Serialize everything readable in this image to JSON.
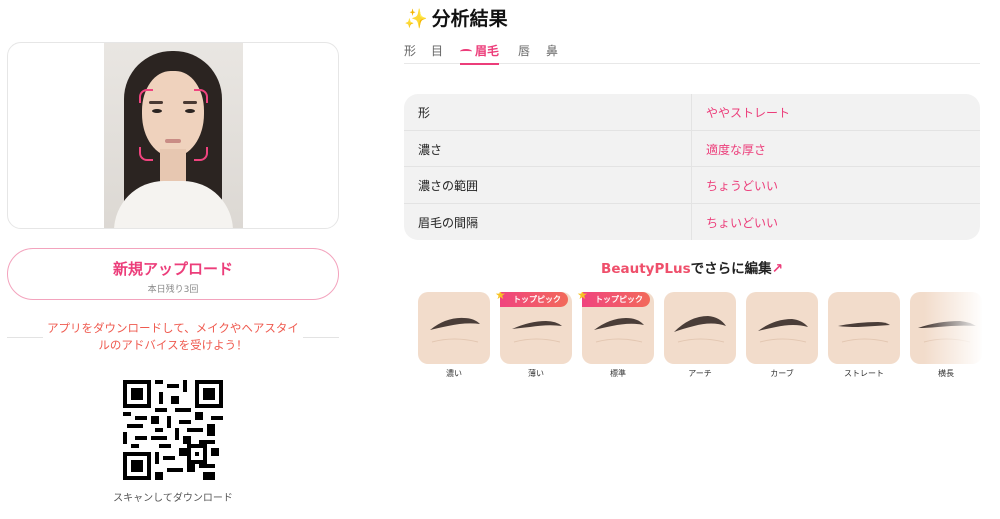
{
  "upload": {
    "title": "新規アップロード",
    "remaining": "本日残り3回"
  },
  "promo": {
    "line1": "アプリをダウンロードして、メイクやヘアスタイ",
    "line2": "ルのアドバイスを受けよう！"
  },
  "qr": {
    "caption": "スキャンしてダウンロード"
  },
  "analysis": {
    "sparkle": "✨",
    "title": "分析結果",
    "tabs": [
      "形",
      "目",
      "眉毛",
      "唇",
      "鼻"
    ],
    "active_tab": "眉毛",
    "rows": [
      {
        "label": "形",
        "value": "ややストレート"
      },
      {
        "label": "濃さ",
        "value": "適度な厚さ"
      },
      {
        "label": "濃さの範囲",
        "value": "ちょうどいい"
      },
      {
        "label": "眉毛の間隔",
        "value": "ちょいどいい"
      }
    ]
  },
  "edit_link": {
    "brand": "BeautyPLus",
    "text": "でさらに編集",
    "arrow": "↗"
  },
  "eyebrow_styles": [
    {
      "name": "濃い",
      "badge": ""
    },
    {
      "name": "薄い",
      "badge": "トップピック"
    },
    {
      "name": "標準",
      "badge": "トップピック"
    },
    {
      "name": "アーチ",
      "badge": ""
    },
    {
      "name": "カーブ",
      "badge": ""
    },
    {
      "name": "ストレート",
      "badge": ""
    },
    {
      "name": "横長",
      "badge": ""
    }
  ],
  "colors": {
    "accent": "#ec3d7a",
    "promo_text": "#ef5a4f",
    "table_bg": "#f2f2f2",
    "thumb_bg": "#f2dccb"
  }
}
